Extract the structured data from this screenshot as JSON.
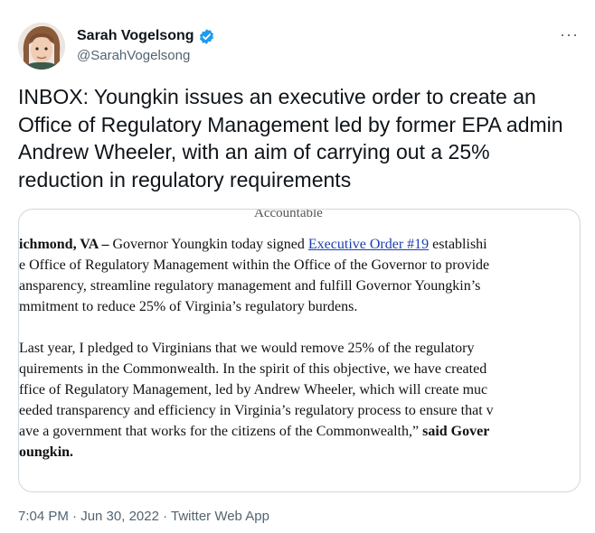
{
  "author": {
    "name": "Sarah Vogelsong",
    "handle": "@SarahVogelsong",
    "verified_color": "#1d9bf0"
  },
  "more_label": "···",
  "tweet_text": "INBOX: Youngkin issues an executive order to create an Office of Regulatory Management led by former EPA admin Andrew Wheeler, with an aim of carrying out a 25% reduction in regulatory requirements",
  "document": {
    "header_fragment": "Accountable",
    "para1": {
      "dateline": "ichmond, VA –",
      "line1_pre": " Governor Youngkin today signed ",
      "link": "Executive Order #19",
      "line1_post": " establishi",
      "line2": "e Office of Regulatory Management within the Office of the Governor to provide",
      "line3": "ansparency, streamline regulatory management and fulfill Governor Youngkin’s",
      "line4": "mmitment to reduce 25% of Virginia’s regulatory burdens."
    },
    "para2": {
      "line1": "Last year, I pledged to Virginians that we would remove 25% of the regulatory",
      "line2": "quirements in the Commonwealth. In the spirit of this objective, we have created",
      "line3": "ffice of Regulatory Management, led by Andrew Wheeler, which will create muc",
      "line4": "eeded transparency and efficiency in Virginia’s regulatory process to ensure that v",
      "line5_pre": "ave a government that works for the citizens of the Commonwealth,”",
      "line5_bold": " said Gover",
      "line6_bold": "oungkin."
    }
  },
  "timestamp": "7:04 PM · Jun 30, 2022 · Twitter Web App"
}
